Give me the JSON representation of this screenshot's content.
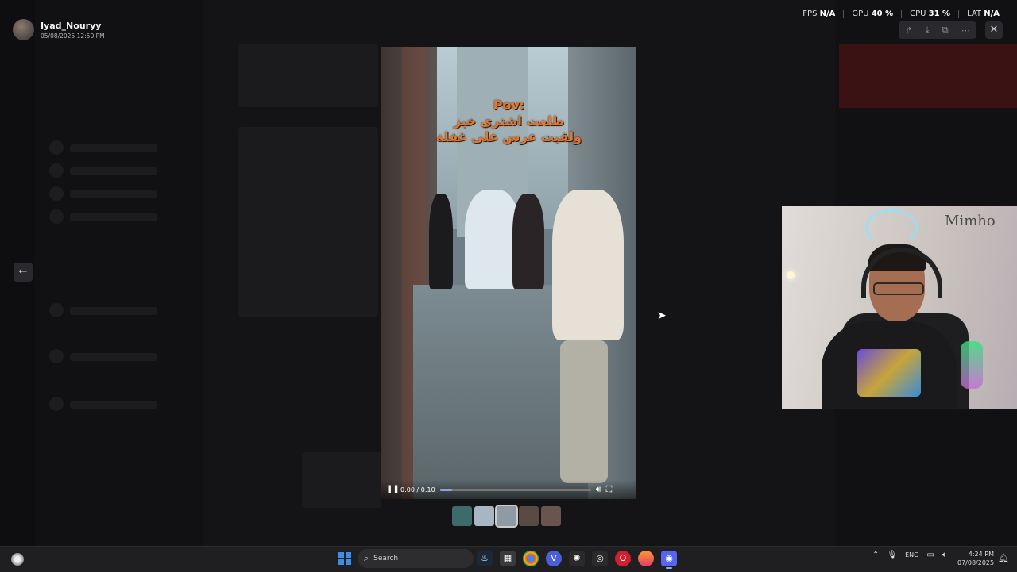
{
  "viewer": {
    "sender_name": "Iyad_Nouryy",
    "sender_date": "05/08/2025 12:50 PM",
    "media": {
      "overlay_lines": [
        "Pov:",
        "طلعت اشتري خبز",
        "ولقيت عرس على غفلة"
      ],
      "time": "0:00 / 0:10",
      "progress": 0.08
    },
    "thumbnail_count": 5,
    "active_thumbnail": 2
  },
  "stats": {
    "fps_label": "FPS",
    "fps_value": "N/A",
    "gpu_label": "GPU",
    "gpu_value": "40 %",
    "cpu_label": "CPU",
    "cpu_value": "31 %",
    "lat_label": "LAT",
    "lat_value": "N/A"
  },
  "webcam": {
    "label": "Mimho"
  },
  "taskbar": {
    "search_placeholder": "Search",
    "language": "ENG",
    "time": "4:24 PM",
    "date": "07/08/2025"
  },
  "icons": {
    "forward": "forward-icon",
    "download": "download-icon",
    "open_external": "open-external-icon",
    "more": "more-icon",
    "close": "close-icon",
    "back": "arrow-left-icon",
    "play_pause": "pause-icon",
    "volume": "volume-icon",
    "fullscreen": "fullscreen-icon"
  }
}
